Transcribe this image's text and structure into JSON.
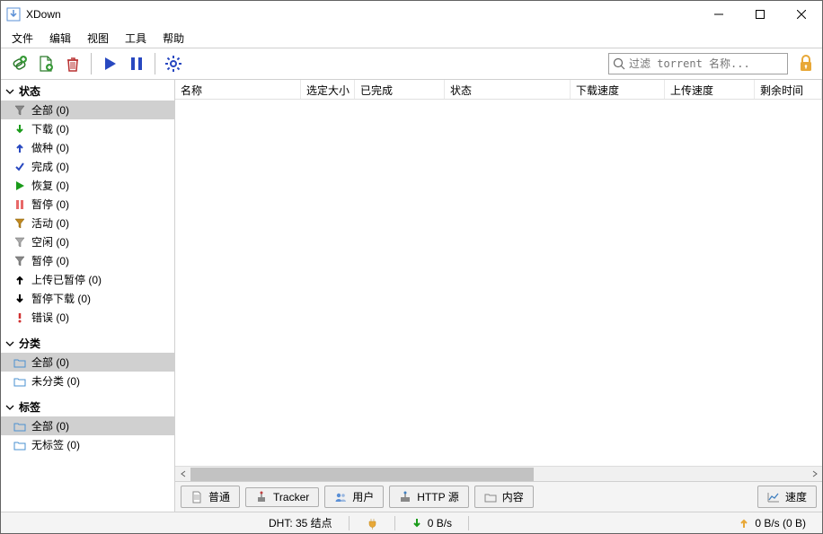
{
  "titlebar": {
    "title": "XDown"
  },
  "menubar": {
    "file": "文件",
    "edit": "编辑",
    "view": "视图",
    "tools": "工具",
    "help": "帮助"
  },
  "toolbar": {
    "search_placeholder": "过滤 torrent 名称..."
  },
  "sidebar": {
    "status_header": "状态",
    "status": [
      {
        "label": "全部 (0)",
        "selected": true
      },
      {
        "label": "下载 (0)"
      },
      {
        "label": "做种 (0)"
      },
      {
        "label": "完成 (0)"
      },
      {
        "label": "恢复 (0)"
      },
      {
        "label": "暂停 (0)"
      },
      {
        "label": "活动 (0)"
      },
      {
        "label": "空闲 (0)"
      },
      {
        "label": "暂停 (0)"
      },
      {
        "label": "上传已暂停 (0)"
      },
      {
        "label": "暂停下载 (0)"
      },
      {
        "label": "错误 (0)"
      }
    ],
    "category_header": "分类",
    "category": [
      {
        "label": "全部 (0)",
        "selected": true
      },
      {
        "label": "未分类 (0)"
      }
    ],
    "tags_header": "标签",
    "tags": [
      {
        "label": "全部 (0)",
        "selected": true
      },
      {
        "label": "无标签 (0)"
      }
    ]
  },
  "columns": {
    "name": "名称",
    "size": "选定大小",
    "done": "已完成",
    "status": "状态",
    "dlspeed": "下载速度",
    "upspeed": "上传速度",
    "eta": "剩余时间"
  },
  "bottom_tabs": {
    "general": "普通",
    "tracker": "Tracker",
    "users": "用户",
    "http": "HTTP 源",
    "content": "内容",
    "speed": "速度"
  },
  "statusbar": {
    "dht": "DHT: 35 结点",
    "down": "0 B/s",
    "up": "0 B/s (0 B)"
  }
}
